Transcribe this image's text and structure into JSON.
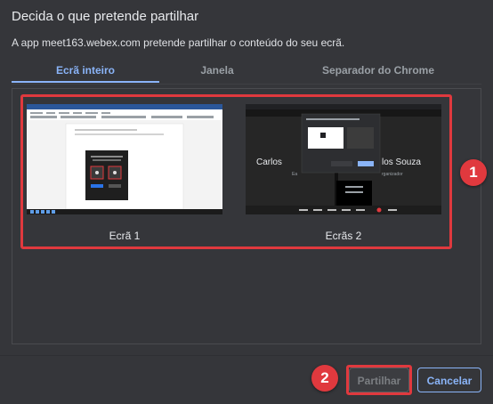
{
  "dialog": {
    "title": "Decida o que pretende partilhar",
    "subtitle": "A app meet163.webex.com pretende partilhar o conteúdo do seu ecrã."
  },
  "tabs": [
    {
      "label": "Ecrã inteiro",
      "active": true
    },
    {
      "label": "Janela",
      "active": false
    },
    {
      "label": "Separador do Chrome",
      "active": false
    }
  ],
  "screens": [
    {
      "label": "Ecrã 1",
      "content": "word-document-icon"
    },
    {
      "label": "Ecrãs 2",
      "content": "webex-meeting-icon",
      "participant_left": "Carlos",
      "participant_right": "los Souza",
      "participant_left_sub": "Ea",
      "participant_right_sub": "rganizador"
    }
  ],
  "annotations": {
    "badge_1": "1",
    "badge_2": "2"
  },
  "buttons": {
    "share_label": "Partilhar",
    "cancel_label": "Cancelar"
  },
  "colors": {
    "background": "#35363a",
    "accent": "#8ab4f8",
    "highlight": "#e0393e",
    "text": "#e8eaed"
  }
}
